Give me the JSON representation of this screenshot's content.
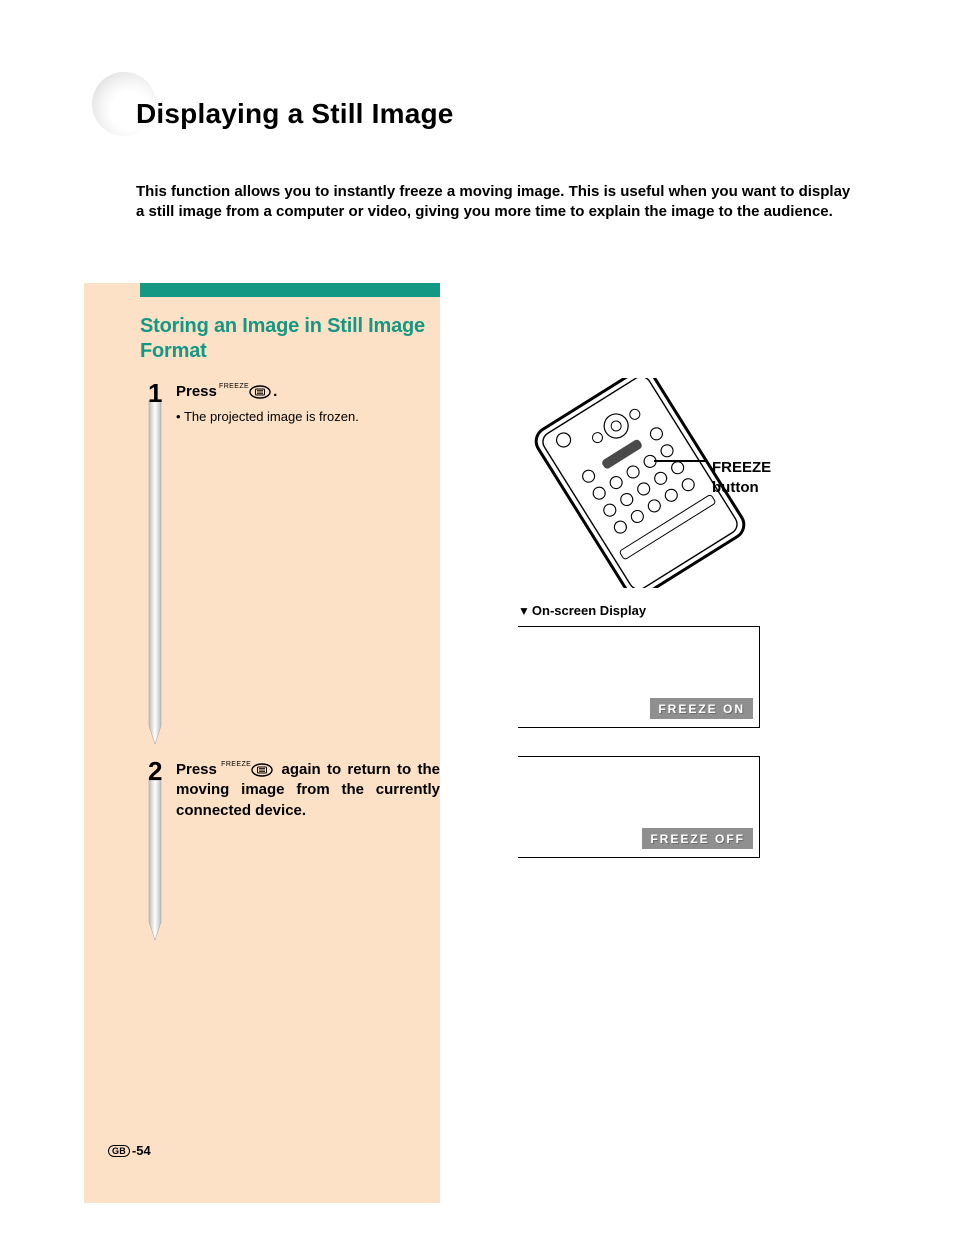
{
  "title": "Displaying a Still Image",
  "intro": "This function allows you to instantly freeze a moving image. This is useful when you want to display a still image from a computer or video, giving you more time to explain the image to the audience.",
  "section_heading": "Storing an Image in Still Image Format",
  "steps": {
    "s1": {
      "num": "1",
      "pre": "Press",
      "icon_label": "FREEZE",
      "post": ".",
      "bullet": "The projected image is frozen."
    },
    "s2": {
      "num": "2",
      "pre": "Press",
      "icon_label": "FREEZE",
      "post": " again to return to the moving image from the currently connected device."
    }
  },
  "callout": {
    "line1": "FREEZE",
    "line2": "button"
  },
  "osd_heading": "On-screen Display",
  "osd": {
    "on": "FREEZE ON",
    "off": "FREEZE OFF"
  },
  "page_region": "GB",
  "page_number": "-54"
}
